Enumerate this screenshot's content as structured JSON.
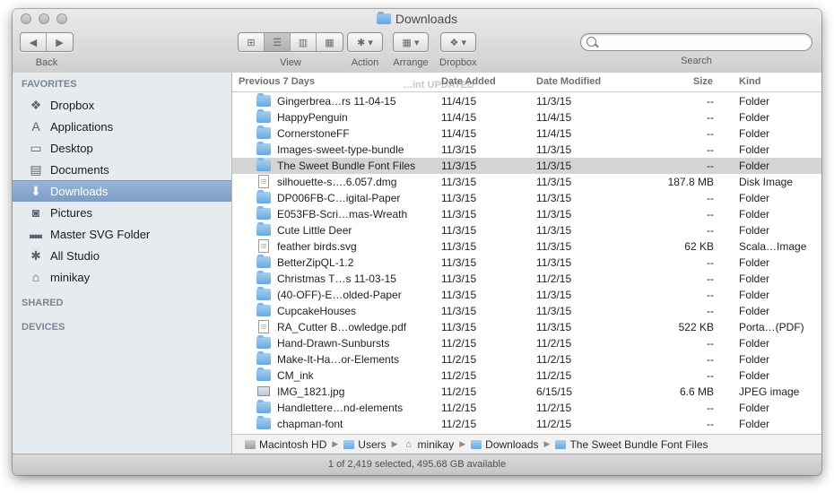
{
  "window": {
    "title": "Downloads"
  },
  "toolbar": {
    "back_label": "Back",
    "view_label": "View",
    "action_label": "Action",
    "arrange_label": "Arrange",
    "dropbox_label": "Dropbox",
    "search_label": "Search",
    "search_value": "",
    "active_view": "list"
  },
  "sidebar": {
    "favorites_header": "FAVORITES",
    "shared_header": "SHARED",
    "devices_header": "DEVICES",
    "items": [
      {
        "label": "Dropbox",
        "icon": "dropbox-icon",
        "glyph": "❖"
      },
      {
        "label": "Applications",
        "icon": "applications-icon",
        "glyph": "A"
      },
      {
        "label": "Desktop",
        "icon": "desktop-icon",
        "glyph": "▭"
      },
      {
        "label": "Documents",
        "icon": "documents-icon",
        "glyph": "▤"
      },
      {
        "label": "Downloads",
        "icon": "downloads-icon",
        "glyph": "⬇",
        "selected": true
      },
      {
        "label": "Pictures",
        "icon": "pictures-icon",
        "glyph": "◙"
      },
      {
        "label": "Master SVG Folder",
        "icon": "folder-icon",
        "glyph": "▬"
      },
      {
        "label": "All Studio",
        "icon": "gear-icon",
        "glyph": "✱"
      },
      {
        "label": "minikay",
        "icon": "home-icon",
        "glyph": "⌂"
      }
    ]
  },
  "columns": {
    "name": "Previous 7 Days",
    "date_added": "Date Added",
    "date_modified": "Date Modified",
    "size": "Size",
    "kind": "Kind",
    "ghost_text": "…int UPDATED"
  },
  "rows": [
    {
      "name": "Gingerbrea…rs 11-04-15",
      "added": "11/4/15",
      "modified": "11/3/15",
      "size": "--",
      "kind": "Folder",
      "icon": "folder"
    },
    {
      "name": "HappyPenguin",
      "added": "11/4/15",
      "modified": "11/4/15",
      "size": "--",
      "kind": "Folder",
      "icon": "folder"
    },
    {
      "name": "CornerstoneFF",
      "added": "11/4/15",
      "modified": "11/4/15",
      "size": "--",
      "kind": "Folder",
      "icon": "folder"
    },
    {
      "name": "Images-sweet-type-bundle",
      "added": "11/3/15",
      "modified": "11/3/15",
      "size": "--",
      "kind": "Folder",
      "icon": "folder"
    },
    {
      "name": "The Sweet Bundle Font Files",
      "added": "11/3/15",
      "modified": "11/3/15",
      "size": "--",
      "kind": "Folder",
      "icon": "folder",
      "selected": true
    },
    {
      "name": "silhouette-s….6.057.dmg",
      "added": "11/3/15",
      "modified": "11/3/15",
      "size": "187.8 MB",
      "kind": "Disk Image",
      "icon": "doc"
    },
    {
      "name": "DP006FB-C…igital-Paper",
      "added": "11/3/15",
      "modified": "11/3/15",
      "size": "--",
      "kind": "Folder",
      "icon": "folder"
    },
    {
      "name": "E053FB-Scri…mas-Wreath",
      "added": "11/3/15",
      "modified": "11/3/15",
      "size": "--",
      "kind": "Folder",
      "icon": "folder"
    },
    {
      "name": "Cute Little Deer",
      "added": "11/3/15",
      "modified": "11/3/15",
      "size": "--",
      "kind": "Folder",
      "icon": "folder"
    },
    {
      "name": "feather birds.svg",
      "added": "11/3/15",
      "modified": "11/3/15",
      "size": "62 KB",
      "kind": "Scala…Image",
      "icon": "doc"
    },
    {
      "name": "BetterZipQL-1.2",
      "added": "11/3/15",
      "modified": "11/3/15",
      "size": "--",
      "kind": "Folder",
      "icon": "folder"
    },
    {
      "name": "Christmas T…s 11-03-15",
      "added": "11/3/15",
      "modified": "11/2/15",
      "size": "--",
      "kind": "Folder",
      "icon": "folder"
    },
    {
      "name": "(40-OFF)-E…olded-Paper",
      "added": "11/3/15",
      "modified": "11/3/15",
      "size": "--",
      "kind": "Folder",
      "icon": "folder"
    },
    {
      "name": "CupcakeHouses",
      "added": "11/3/15",
      "modified": "11/3/15",
      "size": "--",
      "kind": "Folder",
      "icon": "folder"
    },
    {
      "name": "RA_Cutter B…owledge.pdf",
      "added": "11/3/15",
      "modified": "11/3/15",
      "size": "522 KB",
      "kind": "Porta…(PDF)",
      "icon": "doc"
    },
    {
      "name": "Hand-Drawn-Sunbursts",
      "added": "11/2/15",
      "modified": "11/2/15",
      "size": "--",
      "kind": "Folder",
      "icon": "folder"
    },
    {
      "name": "Make-It-Ha…or-Elements",
      "added": "11/2/15",
      "modified": "11/2/15",
      "size": "--",
      "kind": "Folder",
      "icon": "folder"
    },
    {
      "name": "CM_ink",
      "added": "11/2/15",
      "modified": "11/2/15",
      "size": "--",
      "kind": "Folder",
      "icon": "folder"
    },
    {
      "name": "IMG_1821.jpg",
      "added": "11/2/15",
      "modified": "6/15/15",
      "size": "6.6 MB",
      "kind": "JPEG image",
      "icon": "img"
    },
    {
      "name": "Handlettere…nd-elements",
      "added": "11/2/15",
      "modified": "11/2/15",
      "size": "--",
      "kind": "Folder",
      "icon": "folder"
    },
    {
      "name": "chapman-font",
      "added": "11/2/15",
      "modified": "11/2/15",
      "size": "--",
      "kind": "Folder",
      "icon": "folder"
    }
  ],
  "pathbar": [
    {
      "label": "Macintosh HD",
      "icon": "hd"
    },
    {
      "label": "Users",
      "icon": "fold"
    },
    {
      "label": "minikay",
      "icon": "home"
    },
    {
      "label": "Downloads",
      "icon": "fold"
    },
    {
      "label": "The Sweet Bundle Font Files",
      "icon": "fold"
    }
  ],
  "status": "1 of 2,419 selected, 495.68 GB available"
}
